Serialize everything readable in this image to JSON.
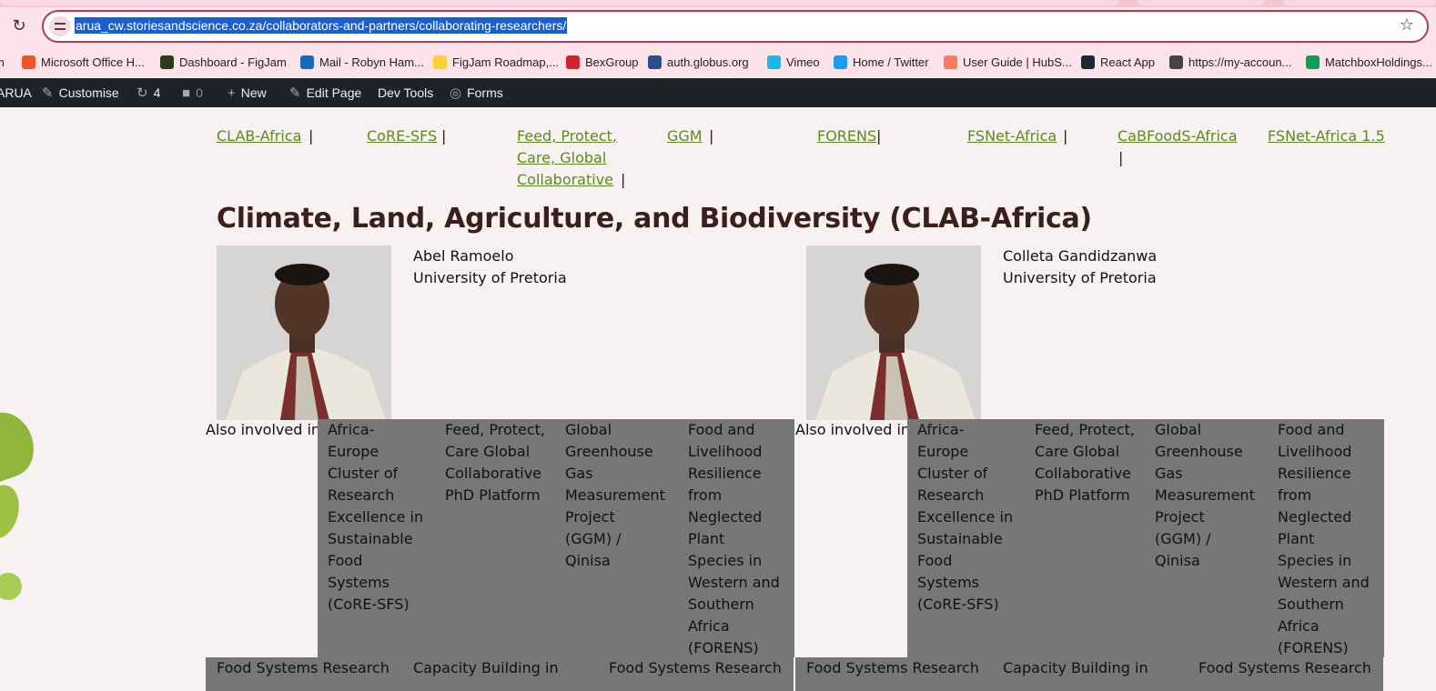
{
  "browser": {
    "url": "arua_cw.storiesandscience.co.za/collaborators-and-partners/collaborating-researchers/",
    "bookmarks": [
      {
        "label": "m",
        "icon": "bookmark-fragment-icon",
        "color": "#f7c6d2"
      },
      {
        "label": "Microsoft Office H...",
        "icon": "microsoft-office-icon",
        "color": "#f35325"
      },
      {
        "label": "Dashboard - FigJam",
        "icon": "figjam-dashboard-icon",
        "color": "#2d3b1a"
      },
      {
        "label": "Mail - Robyn Ham...",
        "icon": "outlook-icon",
        "color": "#0f6cbd"
      },
      {
        "label": "FigJam Roadmap,...",
        "icon": "miro-icon",
        "color": "#ffd02f"
      },
      {
        "label": "BexGroup",
        "icon": "bex-icon",
        "color": "#d3222a"
      },
      {
        "label": "auth.globus.org",
        "icon": "globus-icon",
        "color": "#2b4f8a"
      },
      {
        "label": "Vimeo",
        "icon": "vimeo-icon",
        "color": "#19b7ea"
      },
      {
        "label": "Home / Twitter",
        "icon": "twitter-icon",
        "color": "#1d9bf0"
      },
      {
        "label": "User Guide | HubS...",
        "icon": "hubspot-icon",
        "color": "#ff7a59"
      },
      {
        "label": "React App",
        "icon": "react-icon",
        "color": "#1c2b33"
      },
      {
        "label": "https://my-accoun...",
        "icon": "globe-icon",
        "color": "#444444"
      },
      {
        "label": "MatchboxHoldings...",
        "icon": "sheets-icon",
        "color": "#0f9d58"
      }
    ]
  },
  "adminbar": {
    "site": "ARUA",
    "customise": "Customise",
    "updates_count": "4",
    "comments_count": "0",
    "new": "New",
    "edit_page": "Edit Page",
    "dev_tools": "Dev Tools",
    "forms": "Forms"
  },
  "nav": {
    "links": [
      {
        "label": "CLAB-Africa",
        "pipe": "|"
      },
      {
        "label": "CoRE-SFS",
        "pipe": "|"
      },
      {
        "label_lines": [
          "Feed, Protect,",
          "Care, Global",
          "Collaborative"
        ],
        "pipe": "|"
      },
      {
        "label": "GGM",
        "pipe": "|"
      },
      {
        "label": "FORENS",
        "pipe": "|"
      },
      {
        "label": "FSNet-Africa",
        "pipe": "|"
      },
      {
        "label": "CaBFoodS-Africa",
        "pipe": "|"
      },
      {
        "label": "FSNet-Africa 1.5"
      }
    ]
  },
  "section": {
    "title": "Climate, Land, Agriculture, and Biodiversity (CLAB-Africa)"
  },
  "researchers": [
    {
      "name": "Abel Ramoelo",
      "affiliation": "University of Pretoria",
      "also_label": "Also involved in",
      "projects": [
        [
          "Africa-",
          "Europe",
          "Cluster of",
          "Research",
          "Excellence in",
          "Sustainable",
          "Food",
          "Systems",
          "(CoRE-SFS)"
        ],
        [
          "Feed, Protect,",
          "Care Global",
          "Collaborative",
          "PhD Platform"
        ],
        [
          "Global",
          "Greenhouse",
          "Gas",
          "Measurement",
          "Project",
          "(GGM) /",
          "Qinisa"
        ],
        [
          "Food and",
          "Livelihood",
          "Resilience",
          "from",
          "Neglected",
          "Plant",
          "Species in",
          "Western and",
          "Southern",
          "Africa",
          "(FORENS)"
        ]
      ],
      "bottom": [
        "Food Systems Research",
        "Capacity Building in",
        "Food Systems Research"
      ]
    },
    {
      "name": "Colleta Gandidzanwa",
      "affiliation": "University of Pretoria",
      "also_label": "Also involved in",
      "projects": [
        [
          "Africa-",
          "Europe",
          "Cluster of",
          "Research",
          "Excellence in",
          "Sustainable",
          "Food",
          "Systems",
          "(CoRE-SFS)"
        ],
        [
          "Feed, Protect,",
          "Care Global",
          "Collaborative",
          "PhD Platform"
        ],
        [
          "Global",
          "Greenhouse",
          "Gas",
          "Measurement",
          "Project",
          "(GGM) /",
          "Qinisa"
        ],
        [
          "Food and",
          "Livelihood",
          "Resilience",
          "from",
          "Neglected",
          "Plant",
          "Species in",
          "Western and",
          "Southern",
          "Africa",
          "(FORENS)"
        ]
      ],
      "bottom": [
        "Food Systems Research",
        "Capacity Building in",
        "Food Systems Research"
      ]
    }
  ]
}
